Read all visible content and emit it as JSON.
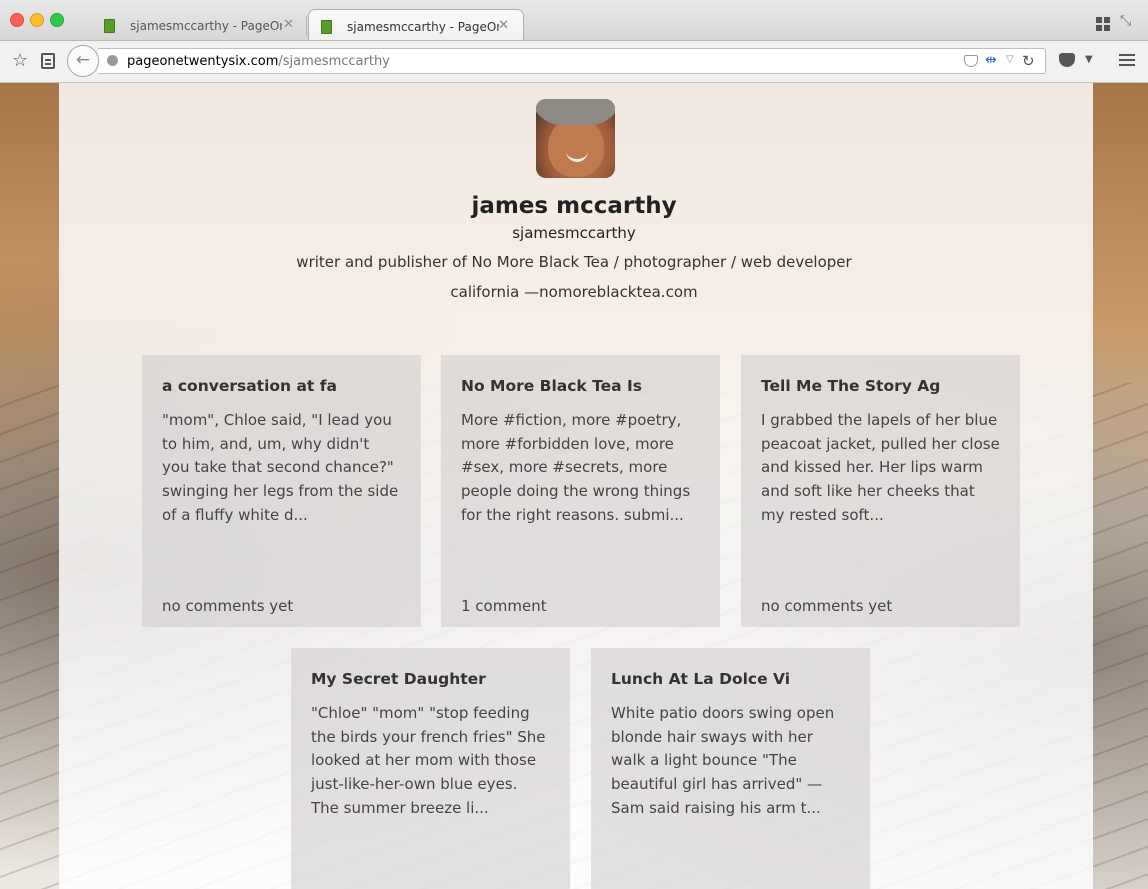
{
  "browser": {
    "tabs": [
      {
        "title": "sjamesmccarthy - PageOn...",
        "active": false
      },
      {
        "title": "sjamesmccarthy - PageOn...",
        "active": true
      }
    ],
    "url": {
      "host": "pageonetwentysix.com",
      "path": "/sjamesmccarthy"
    },
    "icons": [
      "star-icon",
      "reader-icon",
      "back-icon",
      "globe-icon",
      "pocket-icon",
      "sync-icon",
      "reload-icon",
      "menu-icon",
      "tab-grid-icon",
      "expand-icon"
    ]
  },
  "profile": {
    "name": "james mccarthy",
    "handle": "sjamesmccarthy",
    "bio": "writer and publisher of No More Black Tea / photographer / web developer",
    "location": "california —nomoreblacktea.com"
  },
  "posts": [
    {
      "title": "a conversation at fa",
      "excerpt": "\"mom\", Chloe said, \"I lead you to him, and, um, why didn't you take that second chance?\" swinging her legs from the side of a fluffy white d...",
      "comments": "no comments yet"
    },
    {
      "title": "No More Black Tea Is",
      "excerpt": "More #fiction, more #poetry, more #forbidden love, more #sex, more #secrets, more people doing the wrong things for the right reasons. submi...",
      "comments": "1 comment"
    },
    {
      "title": "Tell Me The Story Ag",
      "excerpt": "I grabbed the lapels of her blue peacoat jacket, pulled her close and kissed her. Her lips warm and soft like her cheeks that my rested soft...",
      "comments": "no comments yet"
    },
    {
      "title": "My Secret Daughter",
      "excerpt": "\"Chloe\" \"mom\" \"stop feeding the birds your french fries\" She looked at her mom with those just-like-her-own blue eyes. The summer breeze li...",
      "comments": ""
    },
    {
      "title": "Lunch At La Dolce Vi",
      "excerpt": "White patio doors swing open blonde hair sways with her walk a light bounce \"The beautiful girl has arrived\" — Sam said raising his arm t...",
      "comments": ""
    }
  ]
}
